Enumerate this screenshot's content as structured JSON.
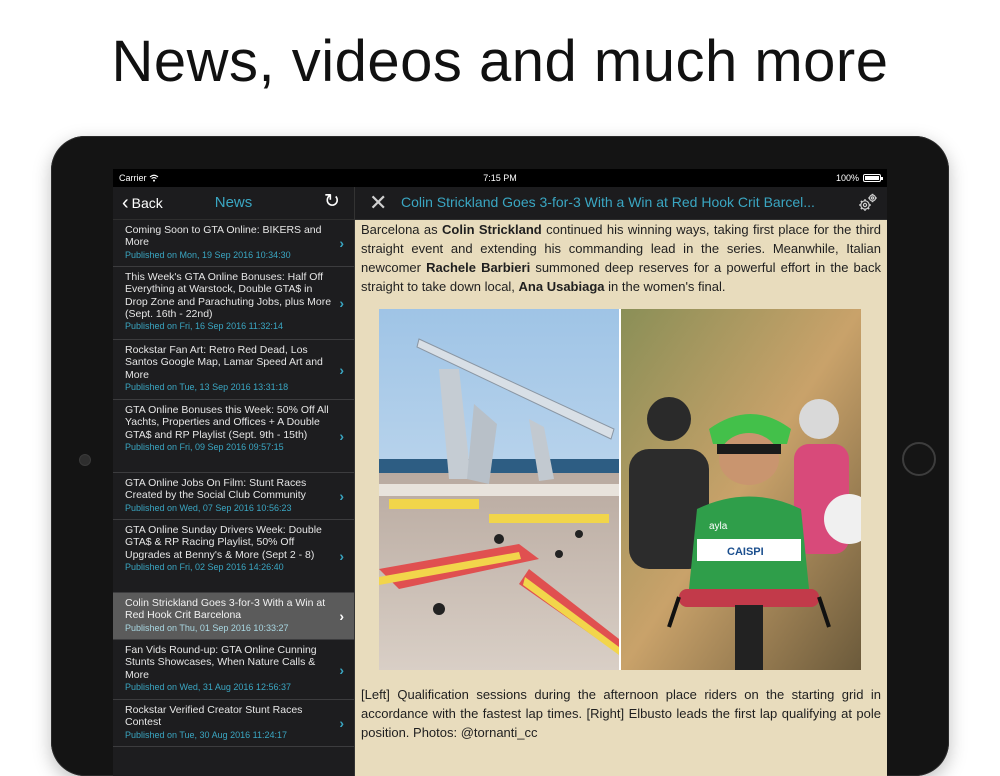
{
  "headline": "News, videos and much more",
  "status_bar": {
    "carrier": "Carrier",
    "time": "7:15 PM",
    "battery": "100%"
  },
  "master": {
    "back_label": "Back",
    "title": "News",
    "items": [
      {
        "title": "Coming Soon to GTA Online: BIKERS and More",
        "date": "Published on Mon, 19 Sep 2016 10:34:30"
      },
      {
        "title": "This Week's GTA Online Bonuses: Half Off Everything at Warstock, Double GTA$ in Drop Zone and Parachuting Jobs, plus More (Sept. 16th - 22nd)",
        "date": "Published on Fri, 16 Sep 2016 11:32:14"
      },
      {
        "title": "Rockstar Fan Art: Retro Red Dead, Los Santos Google Map, Lamar Speed Art and More",
        "date": "Published on Tue, 13 Sep 2016 13:31:18"
      },
      {
        "title": "GTA Online Bonuses this Week: 50% Off All Yachts, Properties and Offices + A Double GTA$ and RP Playlist (Sept. 9th - 15th)",
        "date": "Published on Fri, 09 Sep 2016 09:57:15"
      },
      {
        "title": "GTA Online Jobs On Film: Stunt Races Created by the Social Club Community",
        "date": "Published on Wed, 07 Sep 2016 10:56:23"
      },
      {
        "title": "GTA Online Sunday Drivers Week: Double GTA$ & RP Racing Playlist, 50% Off Upgrades at Benny's & More (Sept 2 - 8)",
        "date": "Published on Fri, 02 Sep 2016 14:26:40"
      },
      {
        "title": "Colin Strickland Goes 3-for-3 With a Win at Red Hook Crit Barcelona",
        "date": "Published on Thu, 01 Sep 2016 10:33:27"
      },
      {
        "title": "Fan Vids Round-up: GTA Online Cunning Stunts Showcases, When Nature Calls & More",
        "date": "Published on Wed, 31 Aug 2016 12:56:37"
      },
      {
        "title": "Rockstar Verified Creator Stunt Races Contest",
        "date": "Published on Tue, 30 Aug 2016 11:24:17"
      }
    ]
  },
  "detail": {
    "title": "Colin Strickland Goes 3-for-3 With a Win at Red Hook Crit Barcel...",
    "para": {
      "t1": "Barcelona as ",
      "b1": "Colin Strickland",
      "t2": " continued his winning ways, taking first place for the third straight event and extending his commanding lead in the series. Meanwhile, Italian newcomer ",
      "b2": "Rachele Barbieri",
      "t3": " summoned deep reserves for a powerful effort in the back straight to take down local, ",
      "b3": "Ana Usabiaga",
      "t4": " in the women's final."
    },
    "caption": "[Left] Qualification sessions during the afternoon place riders on the starting grid in accordance with the fastest lap times. [Right] Elbusto leads the first lap qualifying at pole position. Photos: @tornanti_cc",
    "photo_text": {
      "right_jersey_a": "ayla",
      "right_jersey_b": "CAISPI"
    }
  }
}
